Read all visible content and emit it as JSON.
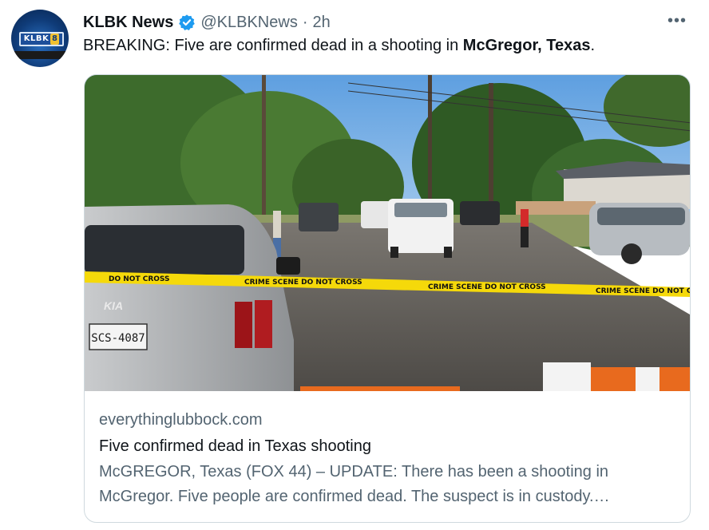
{
  "tweet": {
    "author_name": "KLBK News",
    "handle": "@KLBKNews",
    "separator": "·",
    "time": "2h",
    "avatar_text": "KLBK",
    "avatar_badge": "8",
    "more_label": "•••",
    "text_prefix": "BREAKING: Five are confirmed dead in a shooting in ",
    "text_bold": "McGregor, Texas",
    "text_suffix": "."
  },
  "card": {
    "domain": "everythinglubbock.com",
    "title": "Five confirmed dead in Texas shooting",
    "description": "McGREGOR, Texas (FOX 44) – UPDATE: There has been a shooting in McGregor. Five people are confirmed dead. The suspect is in custody.…",
    "image": {
      "tape_text": "CRIME SCENE DO NOT CROSS",
      "tape_left": "DO NOT CROSS",
      "plate": "SCS-4087",
      "car_badge": "KIA"
    }
  },
  "colors": {
    "verified": "#1d9bf0",
    "muted": "#536471",
    "text": "#0f1419",
    "border": "#cfd9de",
    "tape": "#f5d90a"
  }
}
